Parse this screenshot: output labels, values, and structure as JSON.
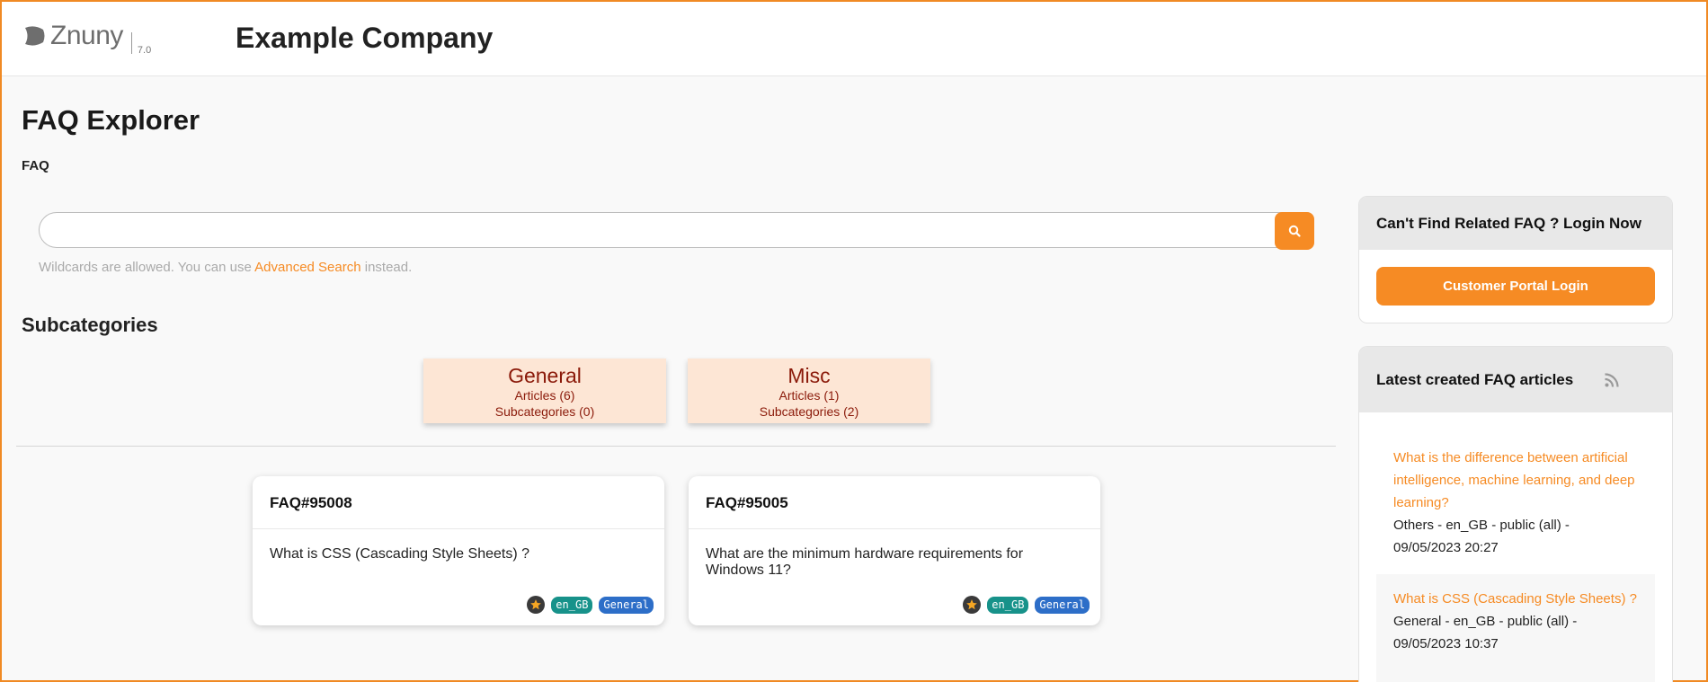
{
  "header": {
    "logo_text": "Znuny",
    "version": "7.0",
    "company": "Example Company"
  },
  "page": {
    "title": "FAQ Explorer",
    "breadcrumb": "FAQ"
  },
  "search": {
    "placeholder": "",
    "value": "",
    "hint_before": "Wildcards are allowed. You can use",
    "hint_link": "Advanced Search",
    "hint_after": "instead."
  },
  "subcategories": {
    "title": "Subcategories",
    "items": [
      {
        "name": "General",
        "articles": "Articles (6)",
        "subcategories": "Subcategories (0)"
      },
      {
        "name": "Misc",
        "articles": "Articles (1)",
        "subcategories": "Subcategories (2)"
      }
    ]
  },
  "faq_cards": [
    {
      "id": "FAQ#95008",
      "question": "What is CSS (Cascading Style Sheets) ?",
      "language": "en_GB",
      "category": "General"
    },
    {
      "id": "FAQ#95005",
      "question": "What are the minimum hardware requirements for Windows 11?",
      "language": "en_GB",
      "category": "General"
    }
  ],
  "sidebar": {
    "login_box": {
      "title": "Can't Find Related FAQ ? Login Now",
      "button": "Customer Portal Login"
    },
    "latest": {
      "title": "Latest created FAQ articles",
      "items": [
        {
          "title": "What is the difference between artificial intelligence, machine learning, and deep learning?",
          "meta": "Others - en_GB - public (all) - 09/05/2023 20:27"
        },
        {
          "title": "What is CSS (Cascading Style Sheets) ?",
          "meta": "General - en_GB - public (all) - 09/05/2023 10:37"
        }
      ]
    }
  },
  "colors": {
    "accent": "#f68b24",
    "category_bg": "#fde6d5",
    "category_text": "#8b1a0a",
    "tag_language": "#17928a",
    "tag_category": "#2d6ec8"
  },
  "icons": {
    "search": "search-icon",
    "rss": "rss-icon",
    "star": "star-icon"
  }
}
